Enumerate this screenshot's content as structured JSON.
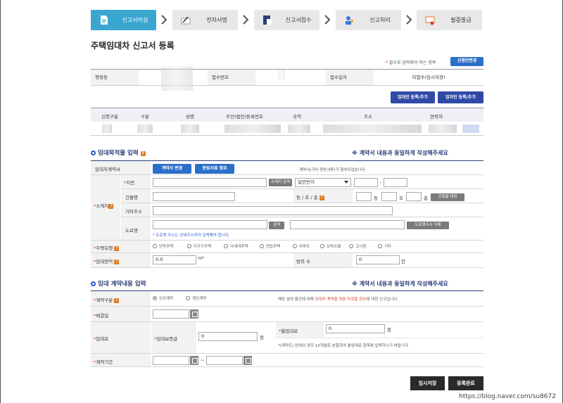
{
  "steps": [
    {
      "label": "신고서작성",
      "icon": "document-icon"
    },
    {
      "label": "전자서명",
      "icon": "pen-sign-icon"
    },
    {
      "label": "신고서접수",
      "icon": "folder-icon"
    },
    {
      "label": "신고처리",
      "icon": "person-process-icon"
    },
    {
      "label": "필증발급",
      "icon": "certificate-icon"
    }
  ],
  "page_title": "주택임대차 신고서 등록",
  "required_note": "필수로 입력해야 하는 항목",
  "required_star": "*",
  "applicant_change_button": "신청인변경",
  "header": {
    "agency_label": "행정동",
    "receipt_no_label": "접수번호",
    "receipt_date_label": "접수일자",
    "receipt_date_value": "미접수(임시저장)"
  },
  "lessor_add_button": "임대인 등록/추가",
  "lessee_add_button": "임차인 등록/추가",
  "party_columns": [
    "신청구분",
    "구분",
    "성명",
    "주민(법인)등록번호",
    "국적",
    "주소",
    "연락처"
  ],
  "section1": {
    "title": "임대목적물 입력",
    "help": "?",
    "note": "※ 계약서 내용과 동일하게 작성해주세요",
    "contract_label": "임대차계약서",
    "contract_change_button": "계약서 변경",
    "evidence_attach_button": "증빙서류 첨부",
    "contract_attach_note": "계약서(기타 증빙서류)가 첨부되었습니다.",
    "location_label": "소재지",
    "lot_label": "지번",
    "location_search_button": "소재지 검색",
    "lot_type_select": "일반번지",
    "dash": "-",
    "building_name_label": "건물명",
    "dong_ho_floor_label": "동 / 호 / 층",
    "dong_suffix": "동",
    "ho_suffix": "호",
    "floor_suffix": "층",
    "building_register_button": "건축물 대장",
    "other_address_label": "기타주소",
    "road_label": "도로명",
    "road_search_button": "검색",
    "road_delete_button": "도로명주소 삭제",
    "road_note": "* 도로명 주소는 상세주소까지 입력해야 합니다.",
    "house_type_label": "주택유형",
    "house_types": [
      "단독주택",
      "다가구주택",
      "다세대주택",
      "연립주택",
      "아파트",
      "오피스텔",
      "고시원",
      "기타"
    ],
    "area_label": "임대면적",
    "area_value": "0.0",
    "area_unit": "m²",
    "rooms_label": "방의 수",
    "rooms_value": "0",
    "rooms_unit": "칸"
  },
  "section2": {
    "title": "임대 계약내용 입력",
    "note": "※ 계약서 내용과 동일하게 작성해주세요",
    "contract_type_label": "계약구분",
    "contract_new": "신규계약",
    "contract_renew": "갱신계약",
    "contract_note_prefix": "해당 임대 물건에 대해 ",
    "contract_note_highlight": "임대차 계약을 처음 하셨을 경우",
    "contract_note_suffix": "에 대한 신고입니다.",
    "signed_date_label": "체결일",
    "rent_label": "임대료",
    "deposit_label": "임대보증금",
    "deposit_value": "0",
    "won": "원",
    "monthly_label": "월임대료",
    "monthly_value": "0",
    "monthly_note": "*(계약도) 연세의 경우 12개월로 분할하여 월임대료 항목에 입력하시기 바랍니다.",
    "period_label": "계약기간",
    "tilde": "~"
  },
  "temp_save_button": "임시저장",
  "register_button": "등록완료",
  "watermark": "https://blog.naver.com/su8672"
}
